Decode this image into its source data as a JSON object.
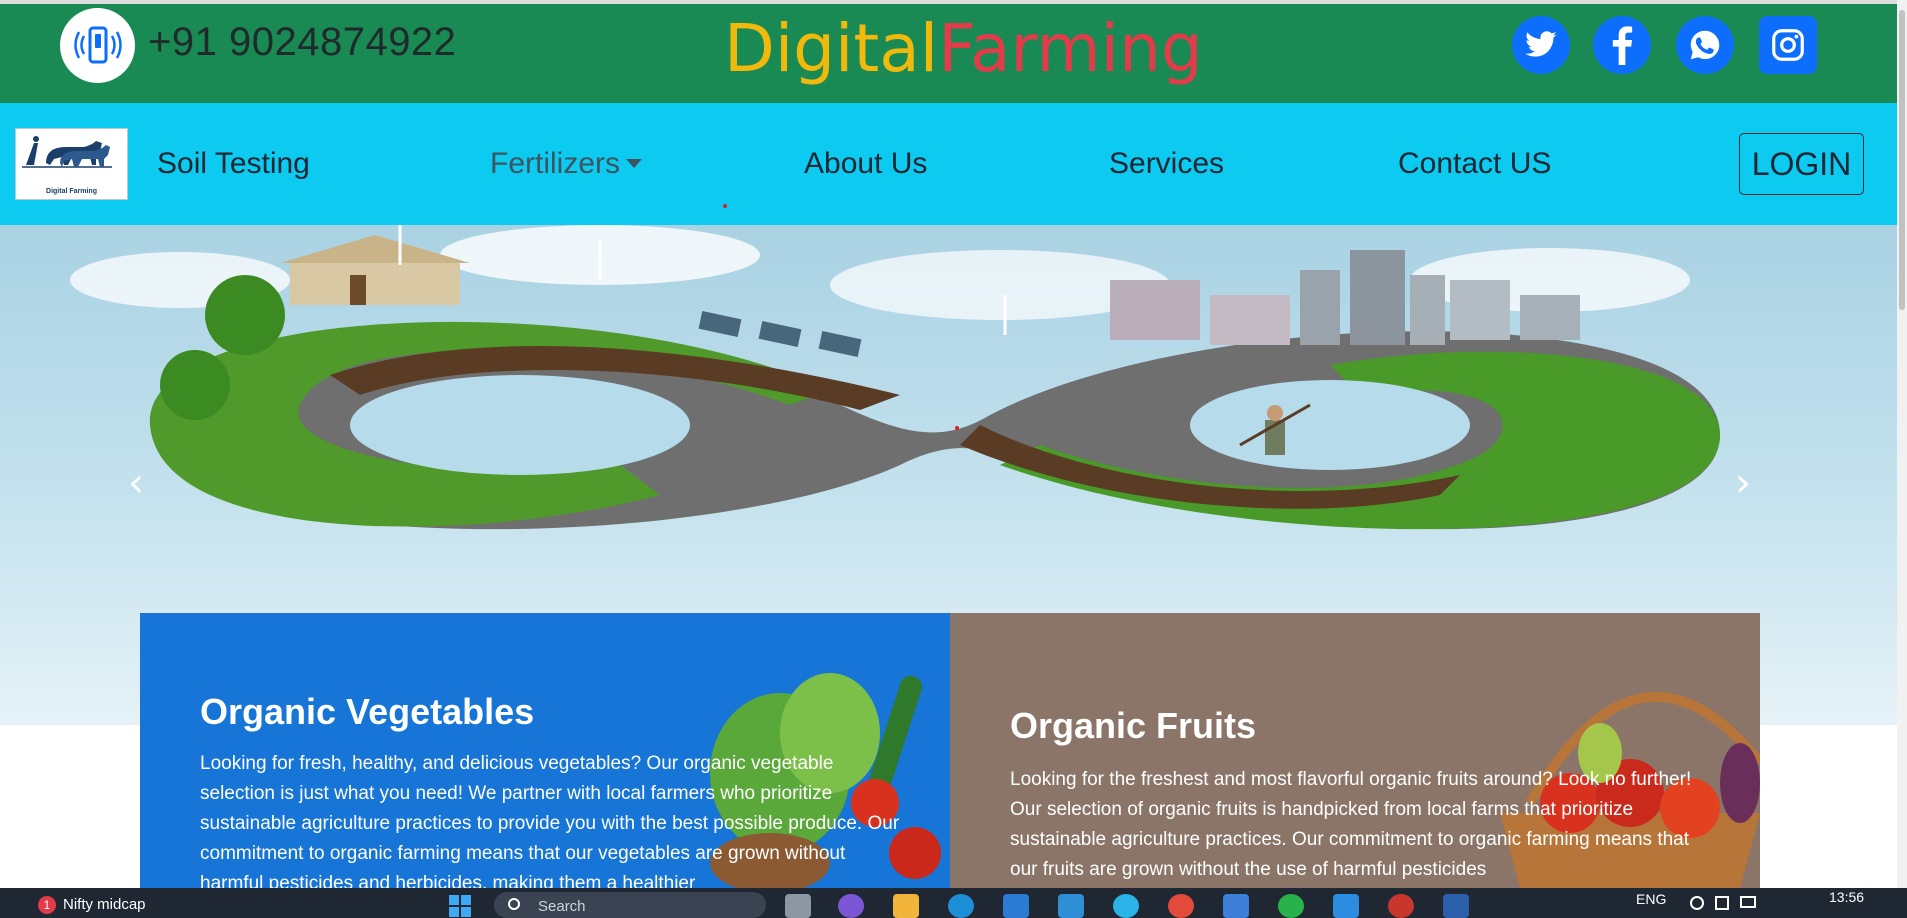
{
  "header": {
    "phone": "+91 9024874922",
    "brand_part1": "Digital",
    "brand_part2": "Farming",
    "social_icons": [
      "twitter-icon",
      "facebook-icon",
      "whatsapp-icon",
      "instagram-icon"
    ],
    "colors": {
      "topbar": "#1a8a54",
      "brand_yellow": "#f0b90b",
      "brand_red": "#e23b4a",
      "social_blue": "#0d6efd"
    }
  },
  "navbar": {
    "logo_text": "Digital Farming",
    "items": [
      "Soil Testing",
      "Fertilizers",
      "About Us",
      "Services",
      "Contact US"
    ],
    "login_label": "LOGIN",
    "color": "#0dcaf0"
  },
  "carousel": {
    "prev_label": "‹",
    "next_label": "›",
    "slide_count": 5,
    "active_slide": 2
  },
  "cards": [
    {
      "title": "Organic Vegetables",
      "body": "Looking for fresh, healthy, and delicious vegetables? Our organic vegetable selection is just what you need! We partner with local farmers who prioritize sustainable agriculture practices to provide you with the best possible produce. Our commitment to organic farming means that our vegetables are grown without harmful pesticides and herbicides, making them a healthier",
      "color": "#1675d6"
    },
    {
      "title": "Organic Fruits",
      "body": "Looking for the freshest and most flavorful organic fruits around? Look no further! Our selection of organic fruits is handpicked from local farms that prioritize sustainable agriculture practices. Our commitment to organic farming means that our fruits are grown without the use of harmful pesticides",
      "color": "#8a7568"
    }
  ],
  "taskbar": {
    "widget_badge": "1",
    "widget_label": "Nifty midcap",
    "search_placeholder": "Search",
    "language": "ENG",
    "time": "13:56"
  }
}
